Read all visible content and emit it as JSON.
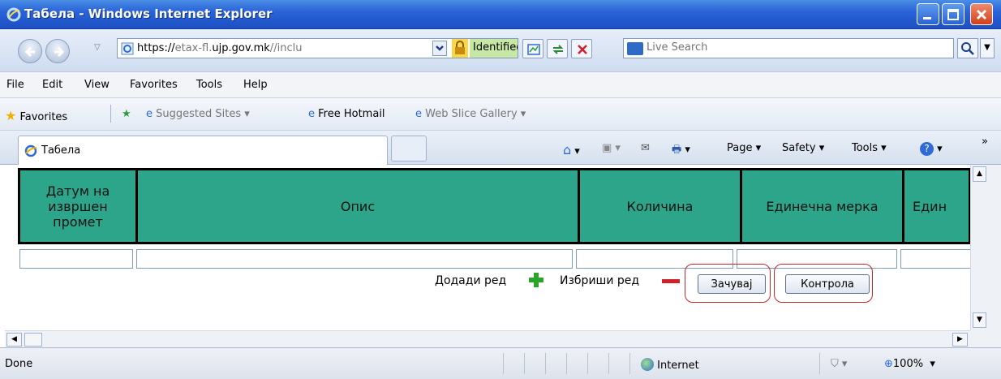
{
  "window": {
    "title": "Табела - Windows Internet Explorer"
  },
  "address": {
    "url_scheme": "https://",
    "url_prefix": "etax-fl.",
    "url_domain": "ujp.gov.mk",
    "url_path": "//inclu",
    "identity": "Identified by thawte",
    "search_placeholder": "Live Search"
  },
  "menu": {
    "file": "File",
    "edit": "Edit",
    "view": "View",
    "favorites": "Favorites",
    "tools": "Tools",
    "help": "Help"
  },
  "favbar": {
    "favorites": "Favorites",
    "suggested": "Suggested Sites ▾",
    "hotmail": "Free Hotmail",
    "webslice": "Web Slice Gallery ▾"
  },
  "tabs": {
    "active": "Табела"
  },
  "commandbar": {
    "page": "Page ▾",
    "safety": "Safety ▾",
    "tools": "Tools ▾",
    "overflow": "»"
  },
  "table": {
    "headers": [
      "Датум на\nизвршен\nпромет",
      "Опис",
      "Количина",
      "Единечна мерка",
      "Един"
    ]
  },
  "actions": {
    "add_row": "Додади ред",
    "delete_row": "Избриши ред",
    "save": "Зачувај",
    "control": "Контрола"
  },
  "status": {
    "text": "Done",
    "zone": "Internet",
    "zoom": "100%"
  },
  "colors": {
    "header_bg": "#2ca58a",
    "highlight": "#c0282e",
    "add": "#2aa52a",
    "remove": "#d0202a"
  }
}
